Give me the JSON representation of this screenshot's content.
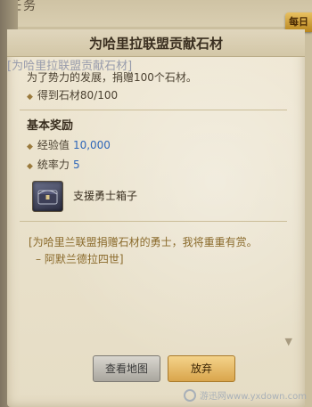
{
  "panel": {
    "title": "任务",
    "daily_badge": "每日"
  },
  "quest": {
    "title": "为哈里拉联盟贡献石材",
    "ghost_text": "[为哈里拉联盟贡献石材]",
    "description": "为了势力的发展，捐赠100个石材。",
    "objectives": [
      {
        "text": "得到石材80/100"
      }
    ]
  },
  "rewards": {
    "title": "基本奖励",
    "items": [
      {
        "label": "经验值",
        "value": "10,000"
      },
      {
        "label": "统率力",
        "value": "5"
      }
    ],
    "item_box": {
      "name": "支援勇士箱子",
      "icon": "treasure-chest-icon"
    }
  },
  "quote": {
    "line1": "[为哈里兰联盟捐赠石材的勇士，我将重重有赏。",
    "line2": "– 阿默兰德拉四世]"
  },
  "buttons": {
    "view_map": "查看地图",
    "abandon": "放弃"
  },
  "watermark": {
    "text": "游迅网www.yxdown.com"
  },
  "colors": {
    "value_blue": "#2f67b8",
    "quote_gold": "#8a6a2b",
    "accent_gold": "#d9a54c"
  }
}
